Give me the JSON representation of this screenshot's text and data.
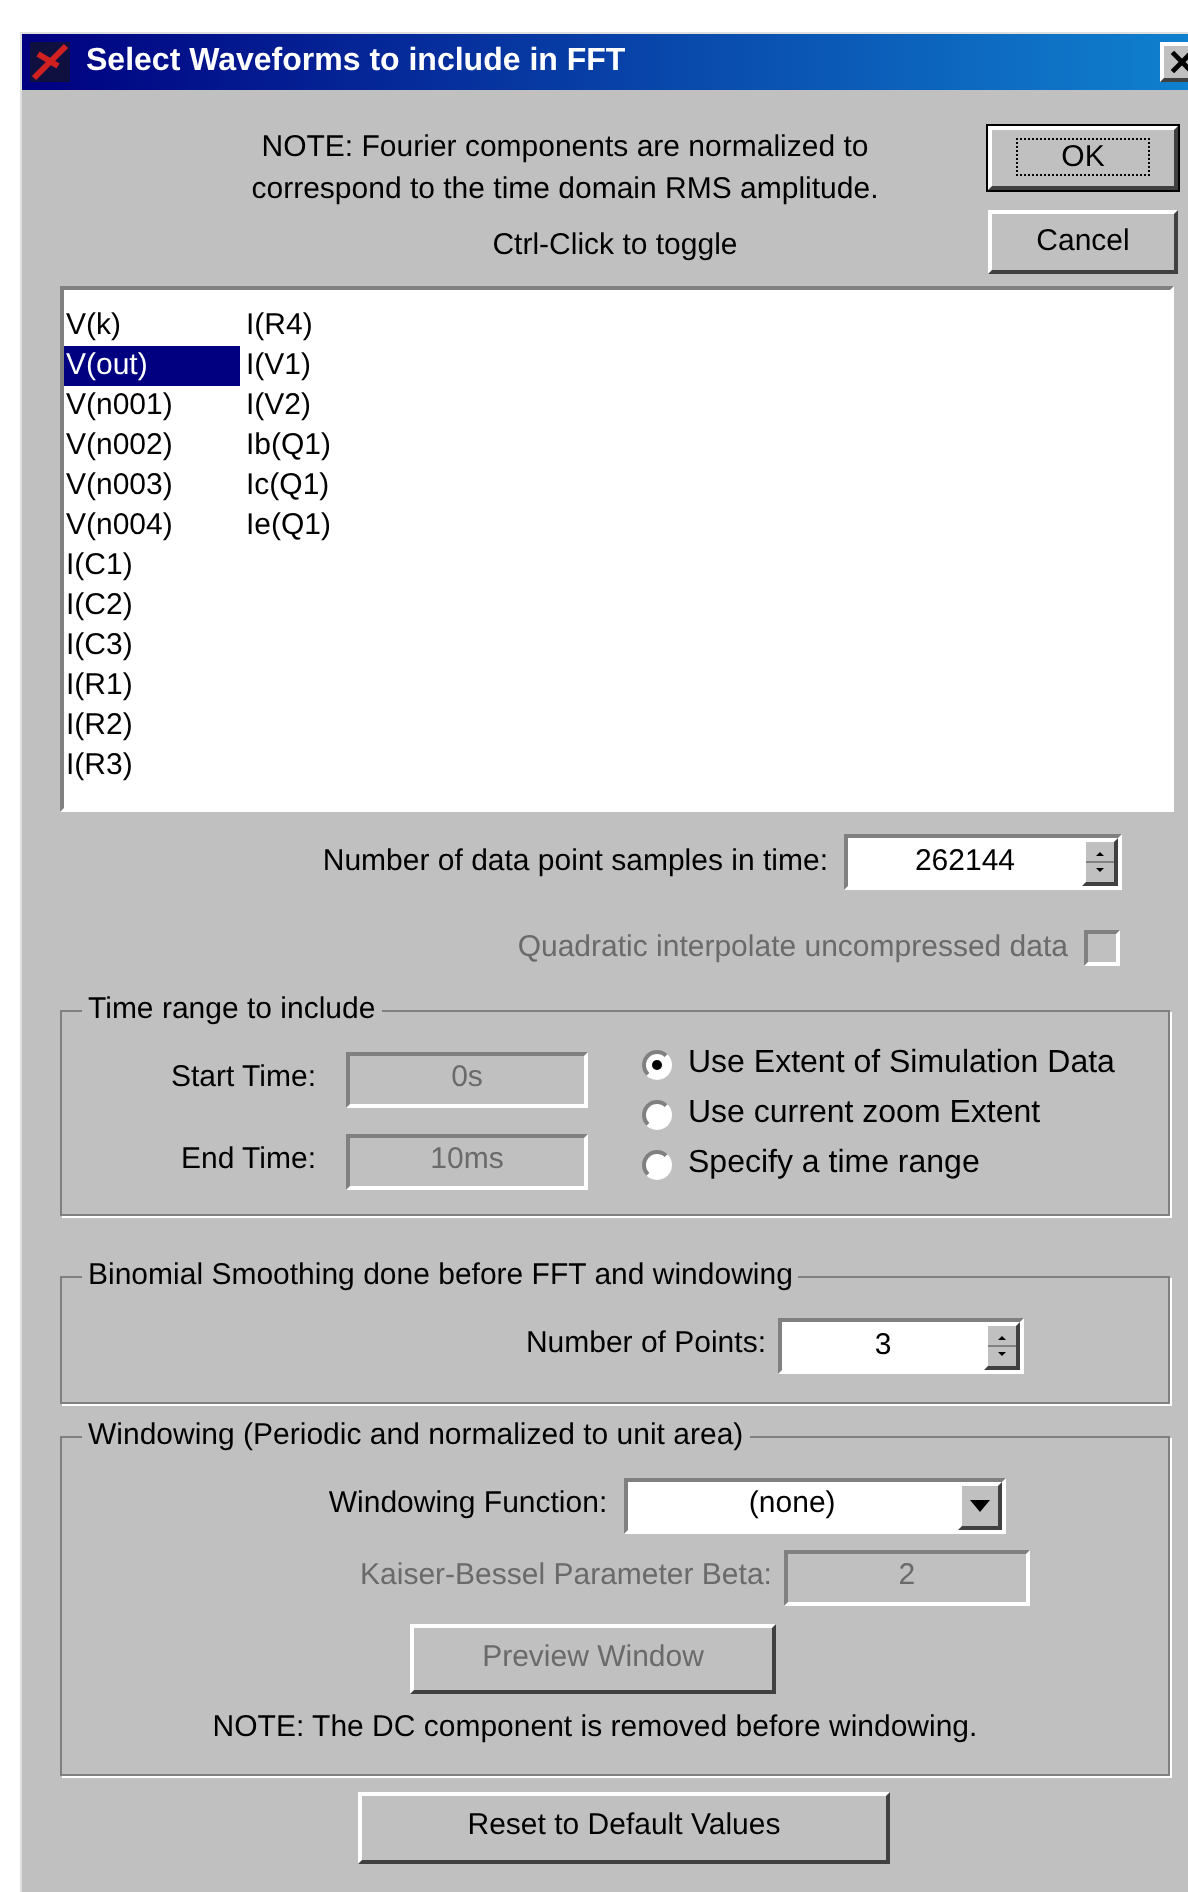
{
  "window": {
    "title": "Select Waveforms to include in FFT"
  },
  "note": "NOTE:  Fourier components are normalized to correspond to the time domain RMS amplitude.",
  "buttons": [
    {
      "label": "OK",
      "default": true
    },
    {
      "label": "Cancel",
      "default": false
    }
  ],
  "hint": "Ctrl-Click to toggle",
  "waveforms": [
    {
      "label": "V(k)",
      "selected": false
    },
    {
      "label": "V(out)",
      "selected": true
    },
    {
      "label": "V(n001)",
      "selected": false
    },
    {
      "label": "V(n002)",
      "selected": false
    },
    {
      "label": "V(n003)",
      "selected": false
    },
    {
      "label": "V(n004)",
      "selected": false
    },
    {
      "label": "I(C1)",
      "selected": false
    },
    {
      "label": "I(C2)",
      "selected": false
    },
    {
      "label": "I(C3)",
      "selected": false
    },
    {
      "label": "I(R1)",
      "selected": false
    },
    {
      "label": "I(R2)",
      "selected": false
    },
    {
      "label": "I(R3)",
      "selected": false
    },
    {
      "label": "I(R4)",
      "selected": false
    },
    {
      "label": "I(V1)",
      "selected": false
    },
    {
      "label": "I(V2)",
      "selected": false
    },
    {
      "label": "Ib(Q1)",
      "selected": false
    },
    {
      "label": "Ic(Q1)",
      "selected": false
    },
    {
      "label": "Ie(Q1)",
      "selected": false
    }
  ],
  "samples": {
    "label": "Number of data point samples in time:",
    "value": "262144"
  },
  "quadratic": {
    "label": "Quadratic interpolate uncompressed data",
    "checked": false,
    "disabled": true
  },
  "time_range": {
    "legend": "Time range to include",
    "start": {
      "label": "Start Time:",
      "value": "0s",
      "disabled": true
    },
    "end": {
      "label": "End Time:",
      "value": "10ms",
      "disabled": true
    },
    "options": [
      {
        "label": "Use Extent of Simulation Data",
        "selected": true
      },
      {
        "label": "Use current zoom Extent",
        "selected": false
      },
      {
        "label": "Specify a time range",
        "selected": false
      }
    ]
  },
  "smoothing": {
    "legend": "Binomial Smoothing done before FFT and windowing",
    "points": {
      "label": "Number of Points:",
      "value": "3"
    }
  },
  "windowing": {
    "legend": "Windowing  (Periodic and normalized to unit area)",
    "function": {
      "label": "Windowing Function:",
      "value": "(none)"
    },
    "beta": {
      "label": "Kaiser-Bessel Parameter Beta:",
      "value": "2",
      "disabled": true
    },
    "preview": {
      "label": "Preview Window",
      "disabled": true
    },
    "note": "NOTE:  The DC component is removed before windowing."
  },
  "reset": "Reset to Default Values"
}
